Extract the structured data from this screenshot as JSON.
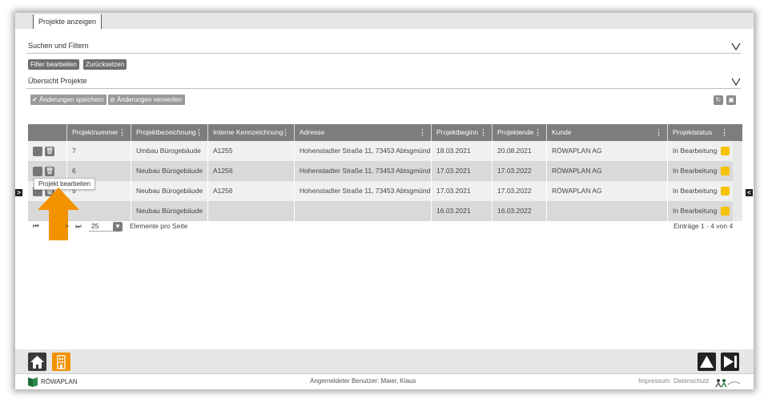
{
  "tab": {
    "label": "Projekte anzeigen"
  },
  "sections": {
    "search": "Suchen und Filtern",
    "overview": "Übersicht Projekte"
  },
  "filter_buttons": {
    "edit": "Filter bearbeiten",
    "reset": "Zurücksetzen"
  },
  "toolbar": {
    "save": "Änderungen speichern",
    "discard": "Änderungen verwerfen"
  },
  "columns": [
    "Projektnummer",
    "Projektbezeichnung",
    "Interne Kennzeichnung",
    "Adresse",
    "Projektbeginn",
    "Projektende",
    "Kunde",
    "Projektstatus"
  ],
  "rows": [
    {
      "nr": "7",
      "bez": "Umbau Bürogebäude",
      "kenn": "A1255",
      "adr": "Hohenstadter Straße 11, 73453 Abtsgmünd",
      "beginn": "18.03.2021",
      "ende": "20.08.2021",
      "kunde": "RÖWAPLAN AG",
      "status": "In Bearbeitung"
    },
    {
      "nr": "6",
      "bez": "Neubau Bürogebäude",
      "kenn": "A1256",
      "adr": "Hohenstadter Straße 11, 73453 Abtsgmünd",
      "beginn": "17.03.2021",
      "ende": "17.03.2022",
      "kunde": "RÖWAPLAN AG",
      "status": "In Bearbeitung"
    },
    {
      "nr": "5",
      "bez": "Neubau Bürogebäude",
      "kenn": "A1256",
      "adr": "Hohenstadter Straße 11, 73453 Abtsgmünd",
      "beginn": "17.03.2021",
      "ende": "17.03.2022",
      "kunde": "RÖWAPLAN AG",
      "status": "In Bearbeitung"
    },
    {
      "nr": "",
      "bez": "Neubau Bürogebäude",
      "kenn": "",
      "adr": "",
      "beginn": "16.03.2021",
      "ende": "16.03.2022",
      "kunde": "",
      "status": "In Bearbeitung"
    }
  ],
  "tooltip": "Projekt bearbeiten",
  "pager": {
    "page_size": "25",
    "per_page_label": "Elemente pro Seite",
    "entries": "Einträge 1 - 4 von 4"
  },
  "statusbar": {
    "brand": "RÖWAPLAN",
    "user": "Angemeldeter Benutzer: Maier, Klaus",
    "impressum": "Impressum",
    "datenschutz": "Datenschutz"
  },
  "colors": {
    "accent_orange": "#f39200",
    "status_yellow": "#f5c100",
    "header_gray": "#7d7d7d",
    "brand_green": "#1d6b3a"
  }
}
